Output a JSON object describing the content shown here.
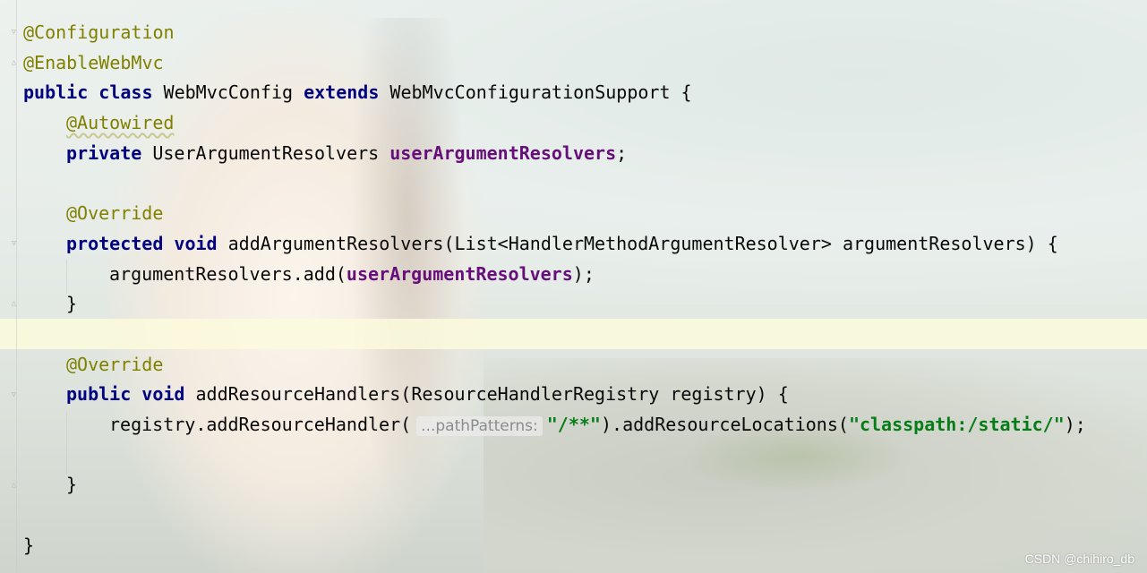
{
  "editor": {
    "lines": [
      {
        "tokens": [
          {
            "t": "@Configuration",
            "c": "ann"
          }
        ]
      },
      {
        "tokens": [
          {
            "t": "@EnableWebMvc",
            "c": "ann"
          }
        ]
      },
      {
        "tokens": [
          {
            "t": "public",
            "c": "kw"
          },
          {
            "t": " "
          },
          {
            "t": "class",
            "c": "kw"
          },
          {
            "t": " WebMvcConfig "
          },
          {
            "t": "extends",
            "c": "kw"
          },
          {
            "t": " WebMvcConfigurationSupport {"
          }
        ]
      },
      {
        "indent": 1,
        "tokens": [
          {
            "t": "@Autowired",
            "c": "ann wavy"
          }
        ]
      },
      {
        "indent": 1,
        "tokens": [
          {
            "t": "private",
            "c": "kw"
          },
          {
            "t": " UserArgumentResolvers "
          },
          {
            "t": "userArgumentResolvers",
            "c": "fld"
          },
          {
            "t": ";"
          }
        ]
      },
      {
        "tokens": []
      },
      {
        "indent": 1,
        "tokens": [
          {
            "t": "@Override",
            "c": "ann"
          }
        ]
      },
      {
        "indent": 1,
        "tokens": [
          {
            "t": "protected",
            "c": "kw"
          },
          {
            "t": " "
          },
          {
            "t": "void",
            "c": "kw"
          },
          {
            "t": " addArgumentResolvers(List<HandlerMethodArgumentResolver> argumentResolvers) {"
          }
        ]
      },
      {
        "indent": 2,
        "tokens": [
          {
            "t": "argumentResolvers.add("
          },
          {
            "t": "userArgumentResolvers",
            "c": "fld"
          },
          {
            "t": ");"
          }
        ]
      },
      {
        "indent": 1,
        "tokens": [
          {
            "t": "}"
          }
        ]
      },
      {
        "tokens": []
      },
      {
        "indent": 1,
        "tokens": [
          {
            "t": "@Override",
            "c": "ann"
          }
        ]
      },
      {
        "indent": 1,
        "tokens": [
          {
            "t": "public",
            "c": "kw"
          },
          {
            "t": " "
          },
          {
            "t": "void",
            "c": "kw"
          },
          {
            "t": " addResourceHandlers(ResourceHandlerRegistry registry) {"
          }
        ]
      },
      {
        "indent": 2,
        "tokens": [
          {
            "t": "registry.addResourceHandler("
          },
          {
            "t": "...pathPatterns:",
            "c": "hint"
          },
          {
            "t": "\"/**\"",
            "c": "str"
          },
          {
            "t": ").addResourceLocations("
          },
          {
            "t": "\"classpath:/static/\"",
            "c": "str"
          },
          {
            "t": ");"
          }
        ]
      },
      {
        "tokens": []
      },
      {
        "indent": 1,
        "tokens": [
          {
            "t": "}"
          }
        ]
      },
      {
        "tokens": []
      },
      {
        "tokens": [
          {
            "t": "}"
          }
        ]
      }
    ]
  },
  "watermark": "CSDN @chihiro_db",
  "colors": {
    "keyword": "#000080",
    "annotation": "#808000",
    "field": "#660e7a",
    "string": "#067d17",
    "current_line": "#fcfadc"
  },
  "icons": [
    "fold-open-icon",
    "fold-close-icon"
  ]
}
